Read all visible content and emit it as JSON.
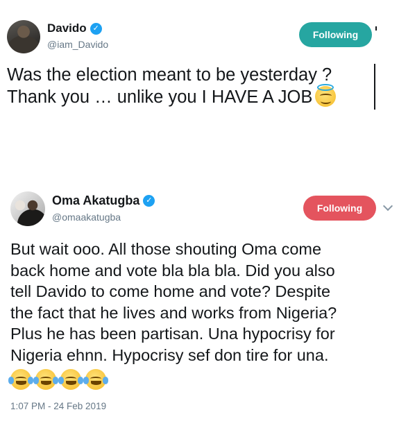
{
  "colors": {
    "follow_teal": "#26a6a1",
    "follow_red": "#e4545e",
    "verified_blue": "#1da1f2",
    "secondary_text": "#657786"
  },
  "tweets": [
    {
      "display_name": "Davido",
      "handle": "@iam_Davido",
      "follow_label": "Following",
      "text": "Was the election meant to be yesterday ?\nThank you … unlike you I HAVE A JOB",
      "inline_emoji": "smiling-face-with-halo"
    },
    {
      "display_name": "Oma Akatugba",
      "handle": "@omaakatugba",
      "follow_label": "Following",
      "text": "But wait ooo. All those shouting Oma come\nback home and vote bla bla bla. Did you also\ntell Davido to come home and vote? Despite\nthe fact that he lives and works from Nigeria?\nPlus he has been partisan. Una hypocrisy for\nNigeria ehnn. Hypocrisy sef don tire for una.",
      "trailing_emojis": [
        "face-with-tears-of-joy",
        "face-with-tears-of-joy",
        "face-with-tears-of-joy",
        "face-with-tears-of-joy"
      ],
      "timestamp": "1:07 PM - 24 Feb 2019"
    }
  ]
}
